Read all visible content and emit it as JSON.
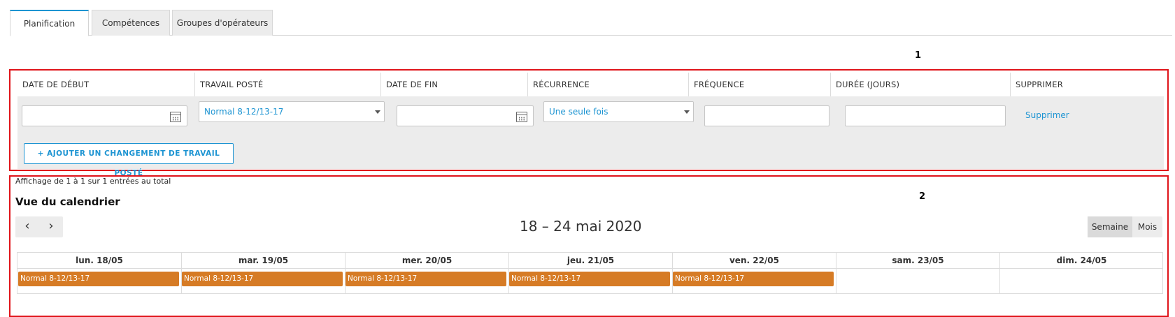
{
  "tabs": [
    {
      "label": "Planification"
    },
    {
      "label": "Compétences"
    },
    {
      "label": "Groupes d'opérateurs"
    }
  ],
  "callouts": {
    "one": "1",
    "two": "2"
  },
  "schedule_table": {
    "headers": [
      "DATE DE DÉBUT",
      "TRAVAIL POSTÉ",
      "DATE DE FIN",
      "RÉCURRENCE",
      "FRÉQUENCE",
      "DURÉE (JOURS)",
      "SUPPRIMER"
    ],
    "row": {
      "start_date": "",
      "shift_work": "Normal 8-12/13-17",
      "end_date": "",
      "recurrence": "Une seule fois",
      "frequency": "",
      "duration_days": "",
      "delete_label": "Supprimer"
    },
    "add_button": "AJOUTER UN CHANGEMENT DE TRAVAIL POSTÉ",
    "add_icon": "+"
  },
  "count_text": "Affichage de 1 à 1 sur 1 entrées au total",
  "calendar": {
    "title": "Vue du calendrier",
    "prev_icon": "‹",
    "next_icon": "›",
    "range": "18 – 24 mai 2020",
    "view_week": "Semaine",
    "view_month": "Mois",
    "days": [
      "lun. 18/05",
      "mar. 19/05",
      "mer. 20/05",
      "jeu. 21/05",
      "ven. 22/05",
      "sam. 23/05",
      "dim. 24/05"
    ],
    "events": [
      "Normal 8-12/13-17",
      "Normal 8-12/13-17",
      "Normal 8-12/13-17",
      "Normal 8-12/13-17",
      "Normal 8-12/13-17"
    ],
    "event_color": "#d67b25"
  },
  "colors": {
    "accent": "#1d94d2",
    "highlight": "#e0141a"
  }
}
